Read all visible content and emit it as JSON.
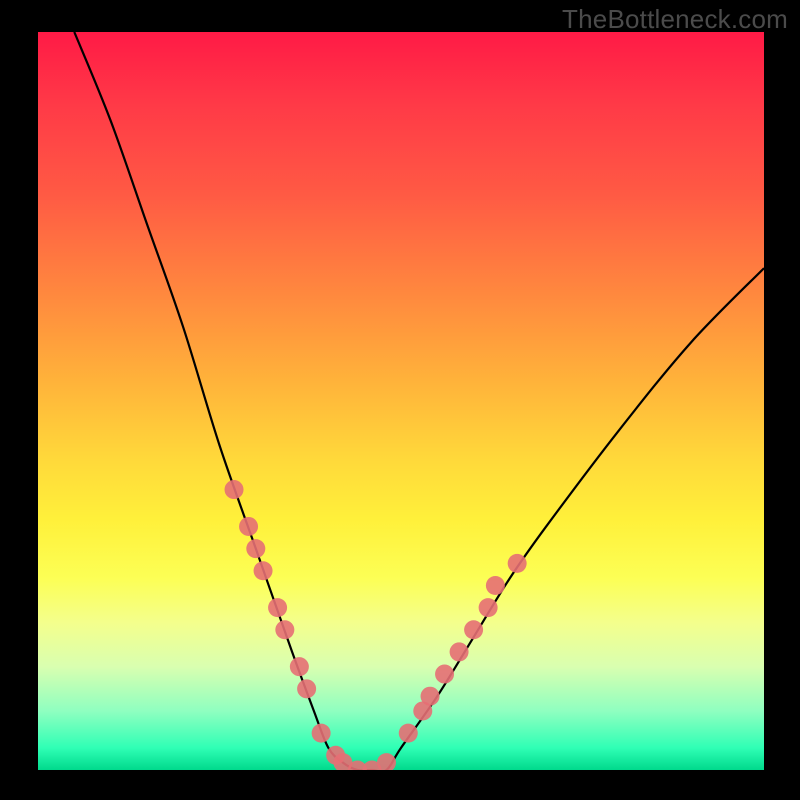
{
  "attribution": "TheBottleneck.com",
  "chart_data": {
    "type": "line",
    "title": "",
    "xlabel": "",
    "ylabel": "",
    "xlim": [
      0,
      100
    ],
    "ylim": [
      0,
      100
    ],
    "series": [
      {
        "name": "curve",
        "x": [
          5,
          10,
          15,
          20,
          25,
          30,
          35,
          38,
          40,
          42,
          44,
          46,
          48,
          50,
          55,
          60,
          65,
          70,
          80,
          90,
          100
        ],
        "values": [
          100,
          88,
          74,
          60,
          44,
          30,
          16,
          8,
          3,
          1,
          0,
          0,
          0,
          3,
          10,
          18,
          26,
          33,
          46,
          58,
          68
        ]
      }
    ],
    "marker_clusters": [
      {
        "name": "left-descent-markers",
        "points": [
          {
            "x": 27,
            "y": 38
          },
          {
            "x": 29,
            "y": 33
          },
          {
            "x": 30,
            "y": 30
          },
          {
            "x": 31,
            "y": 27
          },
          {
            "x": 33,
            "y": 22
          },
          {
            "x": 34,
            "y": 19
          },
          {
            "x": 36,
            "y": 14
          },
          {
            "x": 37,
            "y": 11
          }
        ]
      },
      {
        "name": "valley-markers",
        "points": [
          {
            "x": 39,
            "y": 5
          },
          {
            "x": 41,
            "y": 2
          },
          {
            "x": 42,
            "y": 1
          },
          {
            "x": 44,
            "y": 0
          },
          {
            "x": 46,
            "y": 0
          },
          {
            "x": 48,
            "y": 1
          }
        ]
      },
      {
        "name": "right-ascent-markers",
        "points": [
          {
            "x": 51,
            "y": 5
          },
          {
            "x": 53,
            "y": 8
          },
          {
            "x": 54,
            "y": 10
          },
          {
            "x": 56,
            "y": 13
          },
          {
            "x": 58,
            "y": 16
          },
          {
            "x": 60,
            "y": 19
          },
          {
            "x": 62,
            "y": 22
          },
          {
            "x": 63,
            "y": 25
          },
          {
            "x": 66,
            "y": 28
          }
        ]
      }
    ],
    "gradient_stops": [
      {
        "pos": 0,
        "color": "#ff1a46"
      },
      {
        "pos": 50,
        "color": "#ffd93a"
      },
      {
        "pos": 80,
        "color": "#f4ff8c"
      },
      {
        "pos": 100,
        "color": "#00d98c"
      }
    ]
  }
}
